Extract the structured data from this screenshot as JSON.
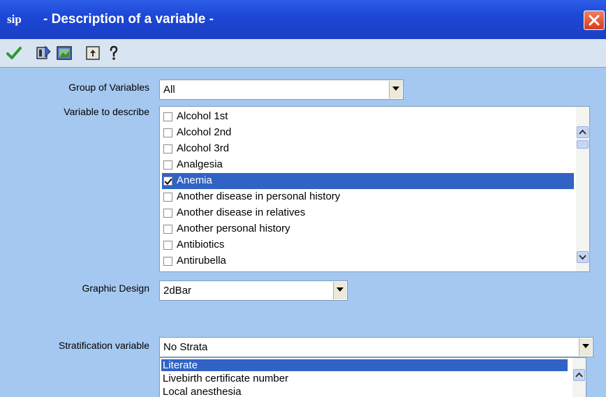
{
  "window": {
    "app_logo": "sip",
    "title": "- Description of a variable -",
    "close_icon": "close-icon"
  },
  "toolbar": {
    "buttons": [
      {
        "icon": "checkmark-icon"
      },
      {
        "icon": "variables-icon"
      },
      {
        "icon": "image-icon"
      },
      {
        "icon": "exit-icon"
      },
      {
        "icon": "help-icon"
      }
    ]
  },
  "form": {
    "group_label": "Group of Variables",
    "group_value": "All",
    "variable_label": "Variable to describe",
    "variables": [
      {
        "label": "Alcohol 1st",
        "checked": false,
        "selected": false
      },
      {
        "label": "Alcohol 2nd",
        "checked": false,
        "selected": false
      },
      {
        "label": "Alcohol 3rd",
        "checked": false,
        "selected": false
      },
      {
        "label": "Analgesia",
        "checked": false,
        "selected": false
      },
      {
        "label": "Anemia",
        "checked": true,
        "selected": true
      },
      {
        "label": "Another disease in personal history",
        "checked": false,
        "selected": false
      },
      {
        "label": "Another disease in relatives",
        "checked": false,
        "selected": false
      },
      {
        "label": "Another personal history",
        "checked": false,
        "selected": false
      },
      {
        "label": "Antibiotics",
        "checked": false,
        "selected": false
      },
      {
        "label": "Antirubella",
        "checked": false,
        "selected": false
      }
    ],
    "graphic_label": "Graphic Design",
    "graphic_value": "2dBar",
    "strat_label": "Stratification variable",
    "strat_value": "No Strata",
    "strat_options": [
      "Literate",
      "Livebirth certificate number",
      "Local anesthesia"
    ]
  },
  "colors": {
    "titlebar": "#1c47d6",
    "selection": "#3163c5",
    "background": "#a5c8f0"
  }
}
